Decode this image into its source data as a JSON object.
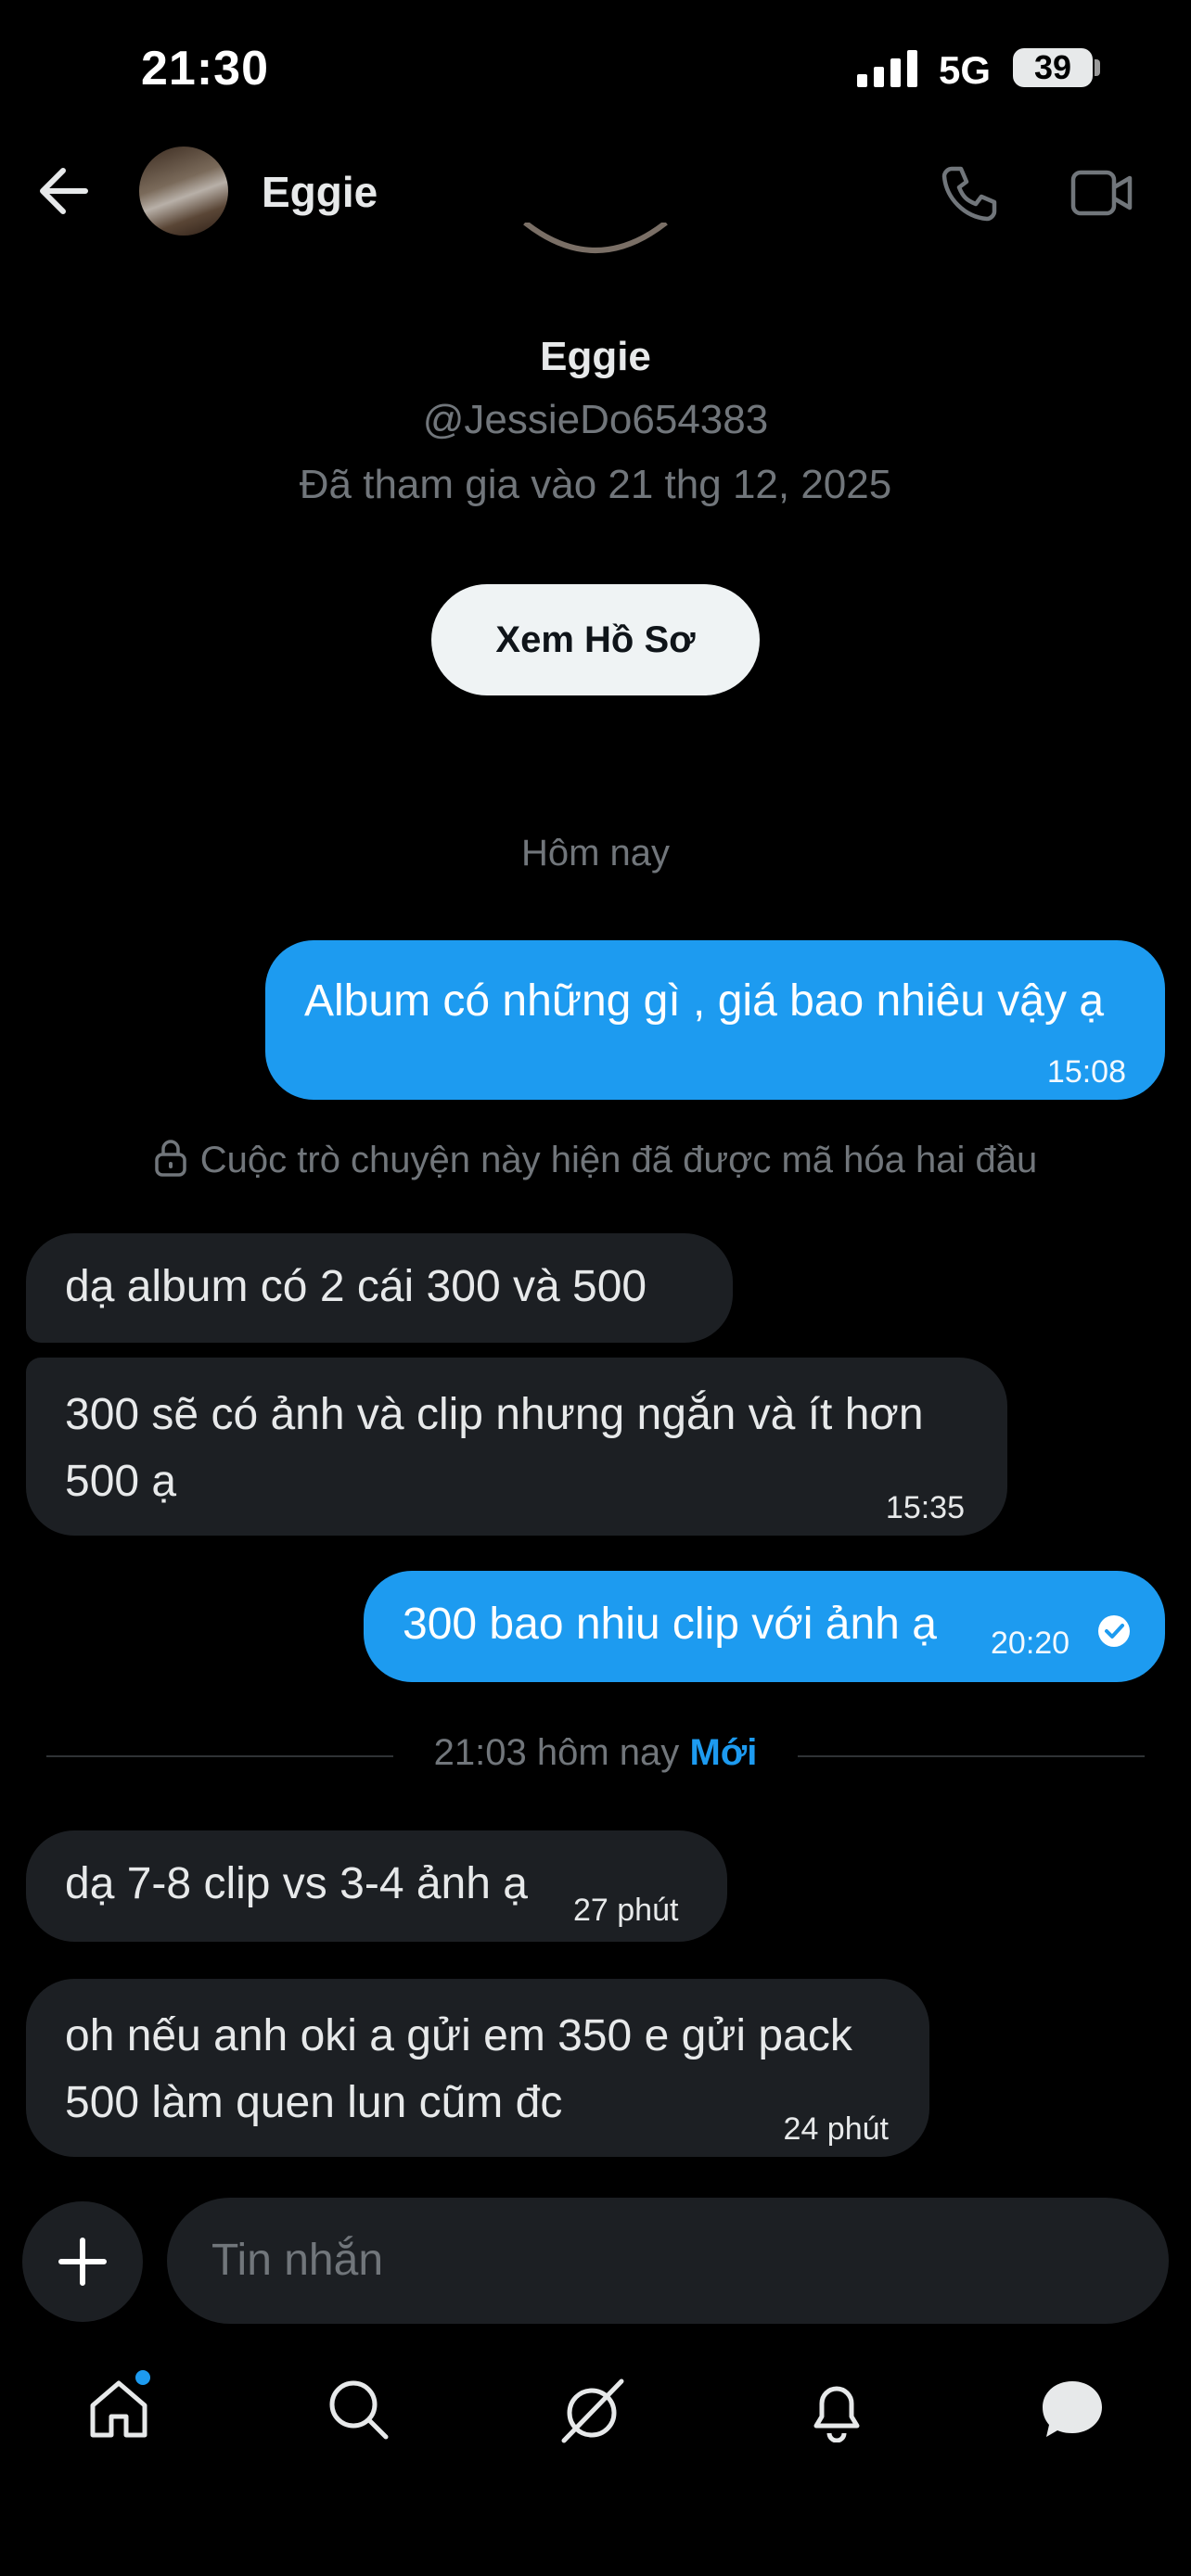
{
  "status_bar": {
    "time": "21:30",
    "network": "5G",
    "battery": "39"
  },
  "header": {
    "name": "Eggie"
  },
  "profile": {
    "name": "Eggie",
    "handle": "@JessieDo654383",
    "joined": "Đã tham gia vào 21 thg 12, 2025",
    "view_profile_label": "Xem Hồ Sơ"
  },
  "conversation": {
    "day_label": "Hôm nay",
    "encryption_notice": "Cuộc trò chuyện này hiện đã được mã hóa hai đầu",
    "messages": [
      {
        "direction": "out",
        "text": "Album có những gì , giá bao nhiêu vậy ạ",
        "time": "15:08"
      },
      {
        "direction": "in",
        "text": "dạ album có 2 cái 300 và 500",
        "time": ""
      },
      {
        "direction": "in",
        "text": "300 sẽ có ảnh và clip nhưng ngắn và ít hơn 500 ạ",
        "time": "15:35"
      },
      {
        "direction": "out",
        "text": "300 bao nhiu clip với ảnh ạ",
        "time": "20:20"
      },
      {
        "direction": "in",
        "text": "dạ 7-8 clip vs 3-4 ảnh ạ",
        "time": "27 phút"
      },
      {
        "direction": "in",
        "text": "oh nếu anh oki a gửi em 350 e gửi pack 500 làm quen lun cũm đc",
        "time": "24 phút"
      }
    ],
    "new_divider": {
      "time": "21:03 hôm nay",
      "new_label": "Mới"
    }
  },
  "composer": {
    "placeholder": "Tin nhắn"
  },
  "tabs": [
    "home-icon",
    "search-icon",
    "grok-icon",
    "bell-icon",
    "messages-icon"
  ],
  "colors": {
    "accent": "#1d9bf0",
    "incoming_bubble": "#1c1f23",
    "background": "#000000"
  }
}
